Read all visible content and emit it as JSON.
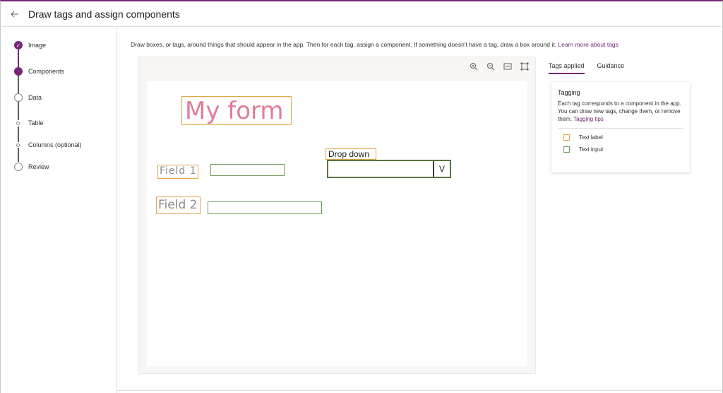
{
  "header": {
    "title": "Draw tags and assign components"
  },
  "steps": [
    {
      "label": "Image"
    },
    {
      "label": "Components"
    },
    {
      "label": "Data"
    },
    {
      "label": "Table"
    },
    {
      "label": "Columns (optional)"
    },
    {
      "label": "Review"
    }
  ],
  "instructions": {
    "text": "Draw boxes, or tags, around things that should appear in the app. Then for each tag, assign a component. If something doesn't have a tag, draw a box around it.",
    "link": "Learn more about tags"
  },
  "sketch": {
    "title": "My form",
    "field1": "Field 1",
    "field2": "Field 2",
    "dropdown_label": "Drop down",
    "dropdown_arrow": "V"
  },
  "panel": {
    "tabs": [
      "Tags applied",
      "Guidance"
    ],
    "card_title": "Tagging",
    "card_text": "Each tag corresponds to a component in the app. You can draw new tags, change them, or remove them.",
    "card_link": "Tagging tips",
    "legend": [
      {
        "label": "Text label",
        "color": "#e3a548"
      },
      {
        "label": "Text input",
        "color": "#6d9b5b"
      }
    ]
  },
  "icons": {
    "back": "back-arrow-icon",
    "zoom_in": "zoom-in-icon",
    "zoom_out": "zoom-out-icon",
    "fit_width": "fit-width-icon",
    "fit_screen": "fit-screen-icon"
  },
  "colors": {
    "accent": "#742774",
    "label_tag": "#e3a548",
    "input_tag": "#6d9b5b"
  }
}
